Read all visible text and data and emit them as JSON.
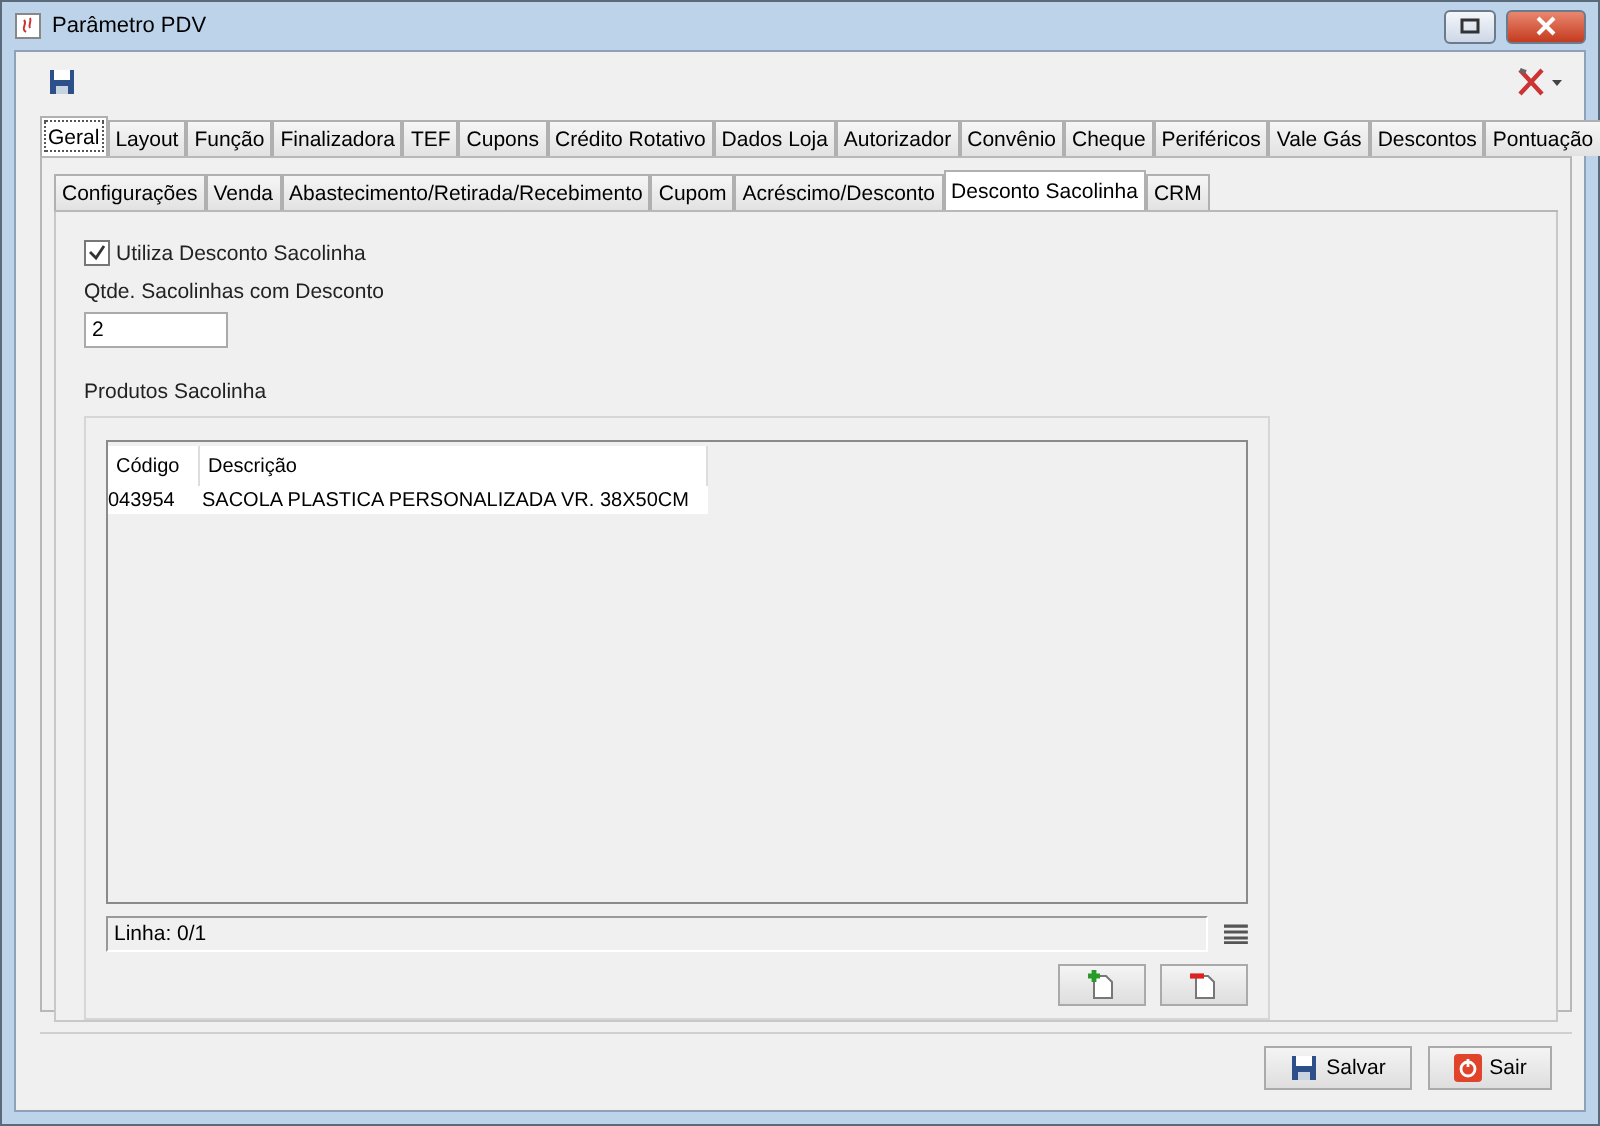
{
  "window": {
    "title": "Parâmetro PDV"
  },
  "main_tabs": [
    {
      "label": "Geral",
      "selected": true
    },
    {
      "label": "Layout",
      "selected": false
    },
    {
      "label": "Função",
      "selected": false
    },
    {
      "label": "Finalizadora",
      "selected": false
    },
    {
      "label": "TEF",
      "selected": false
    },
    {
      "label": "Cupons",
      "selected": false
    },
    {
      "label": "Crédito Rotativo",
      "selected": false
    },
    {
      "label": "Dados Loja",
      "selected": false
    },
    {
      "label": "Autorizador",
      "selected": false
    },
    {
      "label": "Convênio",
      "selected": false
    },
    {
      "label": "Cheque",
      "selected": false
    },
    {
      "label": "Periféricos",
      "selected": false
    },
    {
      "label": "Vale Gás",
      "selected": false
    },
    {
      "label": "Descontos",
      "selected": false
    },
    {
      "label": "Pontuação",
      "selected": false
    }
  ],
  "sub_tabs": [
    {
      "label": "Configurações",
      "selected": false
    },
    {
      "label": "Venda",
      "selected": false
    },
    {
      "label": "Abastecimento/Retirada/Recebimento",
      "selected": false
    },
    {
      "label": "Cupom",
      "selected": false
    },
    {
      "label": "Acréscimo/Desconto",
      "selected": false
    },
    {
      "label": "Desconto Sacolinha",
      "selected": true
    },
    {
      "label": "CRM",
      "selected": false
    }
  ],
  "use_discount": {
    "label": "Utiliza Desconto Sacolinha",
    "checked": true
  },
  "quantity": {
    "label": "Qtde. Sacolinhas com Desconto",
    "value": "2"
  },
  "products": {
    "title": "Produtos Sacolinha",
    "columns": [
      "Código",
      "Descrição"
    ],
    "rows": [
      [
        "043954",
        "SACOLA PLASTICA PERSONALIZADA VR. 38X50CM"
      ]
    ],
    "status": "Linha: 0/1"
  },
  "buttons": [
    {
      "label": "Salvar",
      "kind": "save"
    },
    {
      "label": "Sair",
      "kind": "exit"
    }
  ]
}
